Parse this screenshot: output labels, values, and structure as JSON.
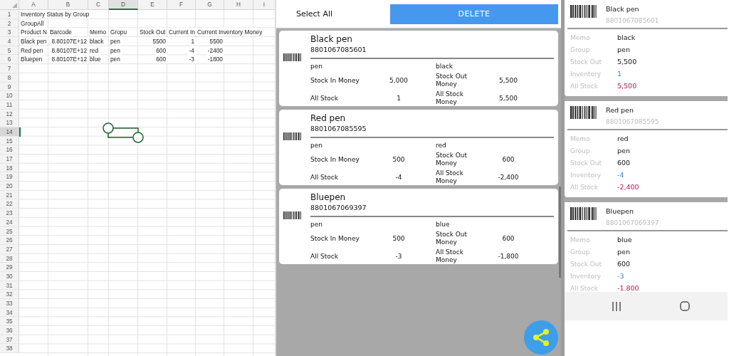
{
  "spreadsheet": {
    "columns": [
      {
        "label": "A",
        "selected": false
      },
      {
        "label": "B",
        "selected": false
      },
      {
        "label": "C",
        "selected": false
      },
      {
        "label": "D",
        "selected": true
      },
      {
        "label": "E",
        "selected": false
      },
      {
        "label": "F",
        "selected": false
      },
      {
        "label": "G",
        "selected": false
      },
      {
        "label": "H",
        "selected": false
      },
      {
        "label": "I",
        "selected": false
      }
    ],
    "rows": [
      {
        "number": "1",
        "selected": false,
        "cells": [
          {
            "text": "Inventory Status by Group",
            "kind": "text"
          }
        ]
      },
      {
        "number": "2",
        "selected": false,
        "cells": [
          {
            "text": "GroupAll",
            "kind": "text"
          }
        ]
      },
      {
        "number": "3",
        "selected": false,
        "cells": [
          {
            "text": "Product N",
            "kind": "text"
          },
          {
            "text": "Barcode",
            "kind": "text"
          },
          {
            "text": "Memo",
            "kind": "text"
          },
          {
            "text": "Gropu",
            "kind": "text"
          },
          {
            "text": "Stock Out",
            "kind": "text"
          },
          {
            "text": "Current In",
            "kind": "text"
          },
          {
            "text": "Current Inventory Money",
            "kind": "text"
          }
        ]
      },
      {
        "number": "4",
        "selected": false,
        "cells": [
          {
            "text": "Black pen",
            "kind": "text"
          },
          {
            "text": "8.80107E+12",
            "kind": "number"
          },
          {
            "text": "black",
            "kind": "text"
          },
          {
            "text": "pen",
            "kind": "text"
          },
          {
            "text": "5500",
            "kind": "number"
          },
          {
            "text": "1",
            "kind": "number"
          },
          {
            "text": "5500",
            "kind": "number"
          }
        ]
      },
      {
        "number": "5",
        "selected": false,
        "cells": [
          {
            "text": "Red pen",
            "kind": "text"
          },
          {
            "text": "8.80107E+12",
            "kind": "number"
          },
          {
            "text": "red",
            "kind": "text"
          },
          {
            "text": "pen",
            "kind": "text"
          },
          {
            "text": "600",
            "kind": "number"
          },
          {
            "text": "-4",
            "kind": "number"
          },
          {
            "text": "-2400",
            "kind": "number"
          }
        ]
      },
      {
        "number": "6",
        "selected": false,
        "cells": [
          {
            "text": "Bluepen",
            "kind": "text"
          },
          {
            "text": "8.80107E+12",
            "kind": "number"
          },
          {
            "text": "blue",
            "kind": "text"
          },
          {
            "text": "pen",
            "kind": "text"
          },
          {
            "text": "600",
            "kind": "number"
          },
          {
            "text": "-3",
            "kind": "number"
          },
          {
            "text": "-1800",
            "kind": "number"
          }
        ]
      },
      {
        "number": "7",
        "selected": false
      },
      {
        "number": "8",
        "selected": false
      },
      {
        "number": "9",
        "selected": false
      },
      {
        "number": "10",
        "selected": false
      },
      {
        "number": "11",
        "selected": false
      },
      {
        "number": "12",
        "selected": false
      },
      {
        "number": "13",
        "selected": false
      },
      {
        "number": "14",
        "selected": true
      },
      {
        "number": "15",
        "selected": false
      },
      {
        "number": "16",
        "selected": false
      },
      {
        "number": "17",
        "selected": false
      },
      {
        "number": "18",
        "selected": false
      },
      {
        "number": "19",
        "selected": false
      },
      {
        "number": "20",
        "selected": false
      },
      {
        "number": "21",
        "selected": false
      },
      {
        "number": "22",
        "selected": false
      },
      {
        "number": "23",
        "selected": false
      },
      {
        "number": "24",
        "selected": false
      },
      {
        "number": "25",
        "selected": false
      },
      {
        "number": "26",
        "selected": false
      },
      {
        "number": "27",
        "selected": false
      },
      {
        "number": "28",
        "selected": false
      },
      {
        "number": "29",
        "selected": false
      },
      {
        "number": "30",
        "selected": false
      },
      {
        "number": "31",
        "selected": false
      },
      {
        "number": "32",
        "selected": false
      },
      {
        "number": "33",
        "selected": false
      },
      {
        "number": "34",
        "selected": false
      },
      {
        "number": "35",
        "selected": false
      },
      {
        "number": "36",
        "selected": false
      },
      {
        "number": "37",
        "selected": false
      },
      {
        "number": "38",
        "selected": false
      }
    ]
  },
  "list_app": {
    "select_all": "Select All",
    "delete_button": "DELETE",
    "cards": [
      {
        "name": "Black pen",
        "barcode": "8801067085601",
        "group": "pen",
        "memo": "black",
        "stats": [
          {
            "label": "Stock In Money",
            "value": "5,000"
          },
          {
            "label": "Stock Out Money",
            "value": "5,500"
          },
          {
            "label": "All Stock",
            "value": "1"
          },
          {
            "label": "All Stock Money",
            "value": "5,500"
          }
        ]
      },
      {
        "name": "Red pen",
        "barcode": "8801067085595",
        "group": "pen",
        "memo": "red",
        "stats": [
          {
            "label": "Stock In Money",
            "value": "500"
          },
          {
            "label": "Stock Out Money",
            "value": "600"
          },
          {
            "label": "All Stock",
            "value": "-4"
          },
          {
            "label": "All Stock Money",
            "value": "-2,400"
          }
        ]
      },
      {
        "name": "Bluepen",
        "barcode": "8801067069397",
        "group": "pen",
        "memo": "blue",
        "stats": [
          {
            "label": "Stock In Money",
            "value": "500"
          },
          {
            "label": "Stock Out Money",
            "value": "600"
          },
          {
            "label": "All Stock",
            "value": "-3"
          },
          {
            "label": "All Stock Money",
            "value": "-1,800"
          }
        ]
      }
    ]
  },
  "detail_app": {
    "cards": [
      {
        "name": "Black pen",
        "barcode": "8801067085601",
        "fields": [
          {
            "label": "Memo",
            "value": "black",
            "kind": "plain"
          },
          {
            "label": "Group",
            "value": "pen",
            "kind": "plain"
          },
          {
            "label": "Stock Out",
            "value": "5,500",
            "kind": "plain"
          },
          {
            "label": "Inventory",
            "value": "1",
            "kind": "inventory"
          },
          {
            "label": "All Stock",
            "value": "5,500",
            "kind": "total"
          }
        ]
      },
      {
        "name": "Red pen",
        "barcode": "8801067085595",
        "fields": [
          {
            "label": "Memo",
            "value": "red",
            "kind": "plain"
          },
          {
            "label": "Group",
            "value": "pen",
            "kind": "plain"
          },
          {
            "label": "Stock Out",
            "value": "600",
            "kind": "plain"
          },
          {
            "label": "Inventory",
            "value": "-4",
            "kind": "inventory"
          },
          {
            "label": "All Stock",
            "value": "-2,400",
            "kind": "total"
          }
        ]
      },
      {
        "name": "Bluepen",
        "barcode": "8801067069397",
        "fields": [
          {
            "label": "Memo",
            "value": "blue",
            "kind": "plain"
          },
          {
            "label": "Group",
            "value": "pen",
            "kind": "plain"
          },
          {
            "label": "Stock Out",
            "value": "600",
            "kind": "plain"
          },
          {
            "label": "Inventory",
            "value": "-3",
            "kind": "inventory"
          },
          {
            "label": "All Stock",
            "value": "-1.800",
            "kind": "total"
          }
        ]
      }
    ]
  }
}
